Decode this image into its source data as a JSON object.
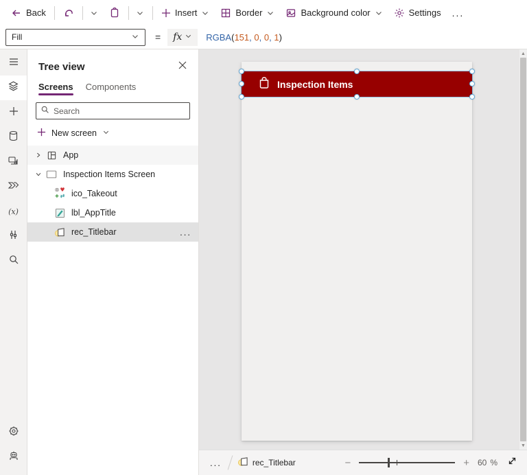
{
  "toolbar": {
    "back_label": "Back",
    "insert_label": "Insert",
    "border_label": "Border",
    "background_color_label": "Background color",
    "settings_label": "Settings",
    "overflow_label": "..."
  },
  "formula_bar": {
    "property_value": "Fill",
    "equals": "=",
    "fx_label": "fx",
    "tokens": [
      {
        "text": "RGBA"
      },
      {
        "text": "("
      },
      {
        "text": "151"
      },
      {
        "text": ", "
      },
      {
        "text": "0"
      },
      {
        "text": ", "
      },
      {
        "text": "0"
      },
      {
        "text": ", "
      },
      {
        "text": "1"
      },
      {
        "text": ")"
      }
    ]
  },
  "left_rail": {
    "items": [
      "menu",
      "tree-view",
      "insert",
      "data",
      "media",
      "power-automate",
      "variables",
      "advanced-tools",
      "search"
    ],
    "bottom_items": [
      "settings",
      "copilot"
    ],
    "variables_glyph": "(x)"
  },
  "tree_panel": {
    "title": "Tree view",
    "tabs": [
      {
        "label": "Screens",
        "selected": true
      },
      {
        "label": "Components",
        "selected": false
      }
    ],
    "search_placeholder": "Search",
    "new_screen_label": "New screen",
    "items": [
      {
        "label": "App"
      },
      {
        "label": "Inspection Items Screen"
      },
      {
        "label": "ico_Takeout"
      },
      {
        "label": "lbl_AppTitle"
      },
      {
        "label": "rec_Titlebar",
        "selected": true,
        "overflow": "..."
      }
    ],
    "takeout_glyphs": {
      "x_circle": "⊗",
      "heart": "♥",
      "plus": "+",
      "arrows": "⇄"
    }
  },
  "canvas": {
    "titlebar": {
      "label": "Inspection Items",
      "fill": "#970000"
    }
  },
  "status_bar": {
    "overflow": "...",
    "breadcrumb_item": "rec_Titlebar",
    "zoom_minus": "−",
    "zoom_plus": "+",
    "zoom_value": "60",
    "zoom_unit": "%"
  },
  "colors": {
    "accent_purple": "#742774",
    "selection_blue": "#62a8d8",
    "titlebar_red": "#970000",
    "formula_function": "#3465a8",
    "formula_number": "#c55b1f"
  }
}
